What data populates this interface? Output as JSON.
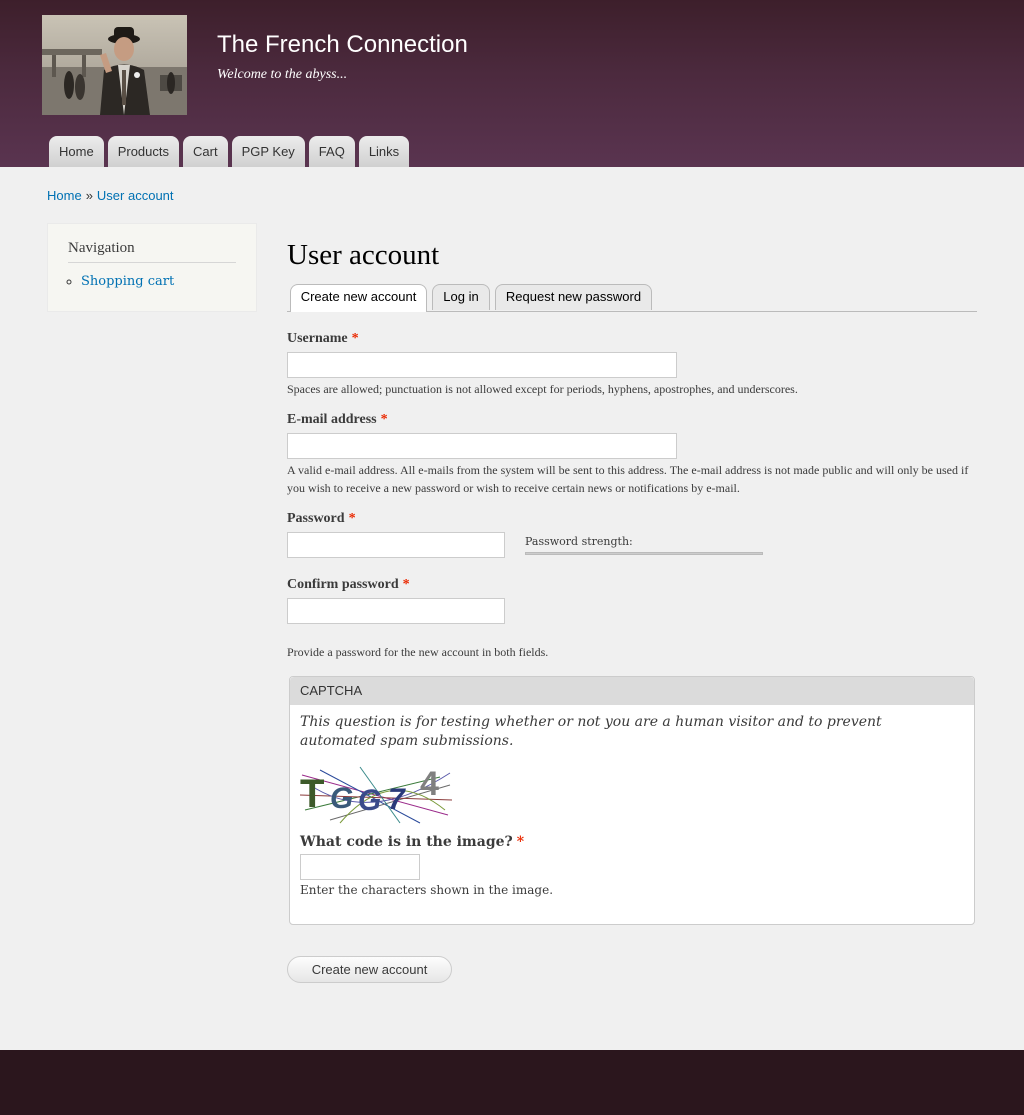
{
  "site": {
    "name": "The French Connection",
    "slogan": "Welcome to the abyss..."
  },
  "main_menu": [
    "Home",
    "Products",
    "Cart",
    "PGP Key",
    "FAQ",
    "Links"
  ],
  "breadcrumb": {
    "home": "Home",
    "separator": "»",
    "current": "User account"
  },
  "sidebar": {
    "title": "Navigation",
    "items": [
      "Shopping cart"
    ]
  },
  "page": {
    "title": "User account",
    "tabs": [
      "Create new account",
      "Log in",
      "Request new password"
    ],
    "active_tab": "Create new account"
  },
  "form": {
    "required_marker": "*",
    "username": {
      "label": "Username",
      "value": "",
      "description": "Spaces are allowed; punctuation is not allowed except for periods, hyphens, apostrophes, and underscores."
    },
    "email": {
      "label": "E-mail address",
      "value": "",
      "description": "A valid e-mail address. All e-mails from the system will be sent to this address. The e-mail address is not made public and will only be used if you wish to receive a new password or wish to receive certain news or notifications by e-mail."
    },
    "password": {
      "label": "Password",
      "value": "",
      "strength_label": "Password strength:",
      "strength_fraction": 0
    },
    "confirm_password": {
      "label": "Confirm password",
      "value": "",
      "description": "Provide a password for the new account in both fields."
    },
    "captcha": {
      "legend": "CAPTCHA",
      "description": "This question is for testing whether or not you are a human visitor and to prevent automated spam submissions.",
      "image_text": "TGG74",
      "question": "What code is in the image?",
      "value": "",
      "help": "Enter the characters shown in the image."
    },
    "submit_label": "Create new account"
  },
  "colors": {
    "header": "#4c2a3e",
    "link": "#0071b3",
    "required": "#ea2800",
    "footer": "#2b161d"
  }
}
